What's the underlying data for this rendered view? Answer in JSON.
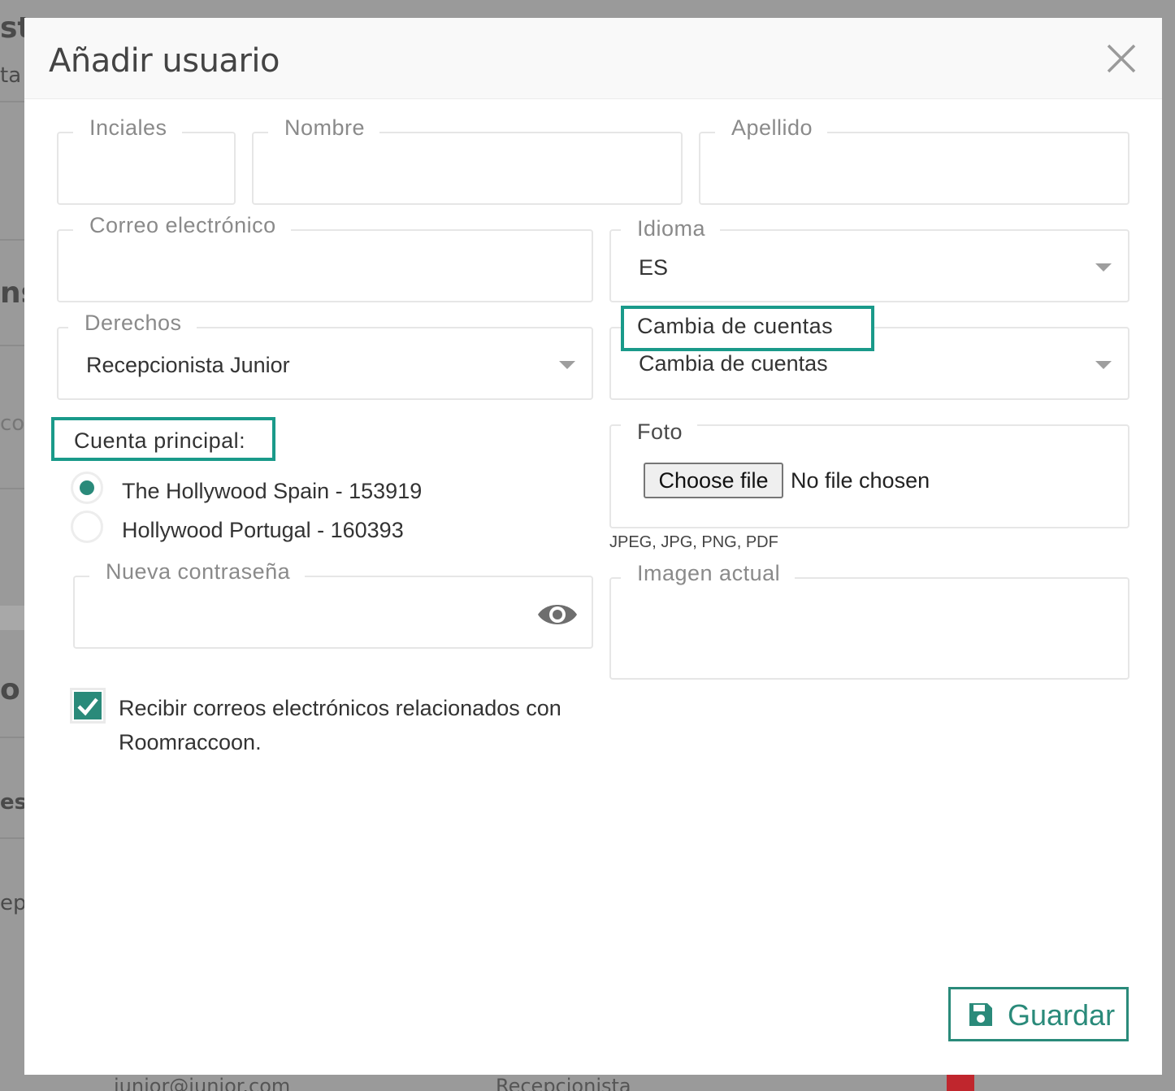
{
  "background_fragments": [
    "st",
    "ta",
    "ns",
    "co",
    "o c",
    "esi",
    "epi",
    "junior@junior.com",
    "Recepcionista"
  ],
  "modal": {
    "title": "Añadir usuario",
    "close_icon": "close-icon"
  },
  "fields": {
    "initials": {
      "label": "Inciales",
      "value": ""
    },
    "first_name": {
      "label": "Nombre",
      "value": ""
    },
    "last_name": {
      "label": "Apellido",
      "value": ""
    },
    "email": {
      "label": "Correo electrónico",
      "value": ""
    },
    "language": {
      "label": "Idioma",
      "value": "ES"
    },
    "rights": {
      "label": "Derechos",
      "value": "Recepcionista Junior"
    },
    "switch_accounts": {
      "label": "Cambia de cuentas",
      "value": "Cambia de cuentas"
    },
    "main_account": {
      "label": "Cuenta principal:",
      "options": [
        {
          "label": "The Hollywood Spain - 153919",
          "selected": true
        },
        {
          "label": "Hollywood Portugal - 160393",
          "selected": false
        }
      ]
    },
    "photo": {
      "label": "Foto",
      "button": "Choose file",
      "status": "No file chosen",
      "hint": "JPEG, JPG, PNG, PDF"
    },
    "new_password": {
      "label": "Nueva contraseña",
      "value": "",
      "icon": "eye-icon"
    },
    "current_image": {
      "label": "Imagen actual"
    },
    "email_opt_in": {
      "label": "Recibir correos electrónicos relacionados con Roomraccoon.",
      "checked": true
    }
  },
  "actions": {
    "save": "Guardar",
    "save_icon": "floppy-disk-icon"
  },
  "colors": {
    "accent": "#2a8a7a",
    "highlight": "#1a9a8a",
    "overlay": "#9a9a9a"
  }
}
